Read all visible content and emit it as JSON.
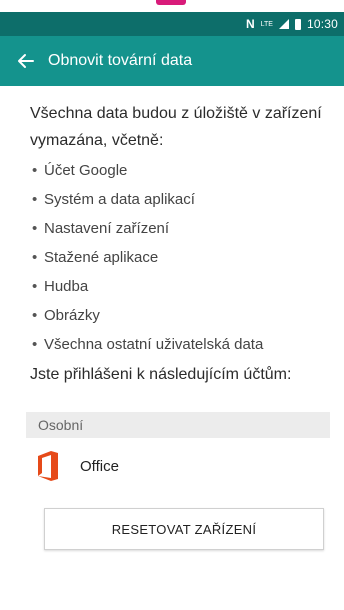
{
  "status_bar": {
    "nfc": "N",
    "network": "LTE",
    "time": "10:30",
    "background": "#0d6e6a",
    "icons": [
      "nfc-icon",
      "lte-icon",
      "signal-icon",
      "battery-icon"
    ]
  },
  "app_bar": {
    "title": "Obnovit tovární data",
    "back_icon": "arrow-left-icon",
    "background": "#14938d"
  },
  "content": {
    "intro": "Všechna data budou z úložiště v zařízení vymazána, včetně:",
    "bullets": [
      "Účet Google",
      "Systém a data aplikací",
      "Nastavení zařízení",
      "Stažené aplikace",
      "Hudba",
      "Obrázky",
      "Všechna ostatní uživatelská data"
    ],
    "accounts_heading": "Jste přihlášeni k následujícím účtům:"
  },
  "accounts": {
    "section_label": "Osobní",
    "items": [
      {
        "name": "Office",
        "icon": "office-icon",
        "color": "#e64a19"
      }
    ]
  },
  "reset_button": {
    "label": "RESETOVAT ZAŘÍZENÍ"
  },
  "colors": {
    "accent": "#14938d",
    "accent_dark": "#0d6e6a"
  }
}
